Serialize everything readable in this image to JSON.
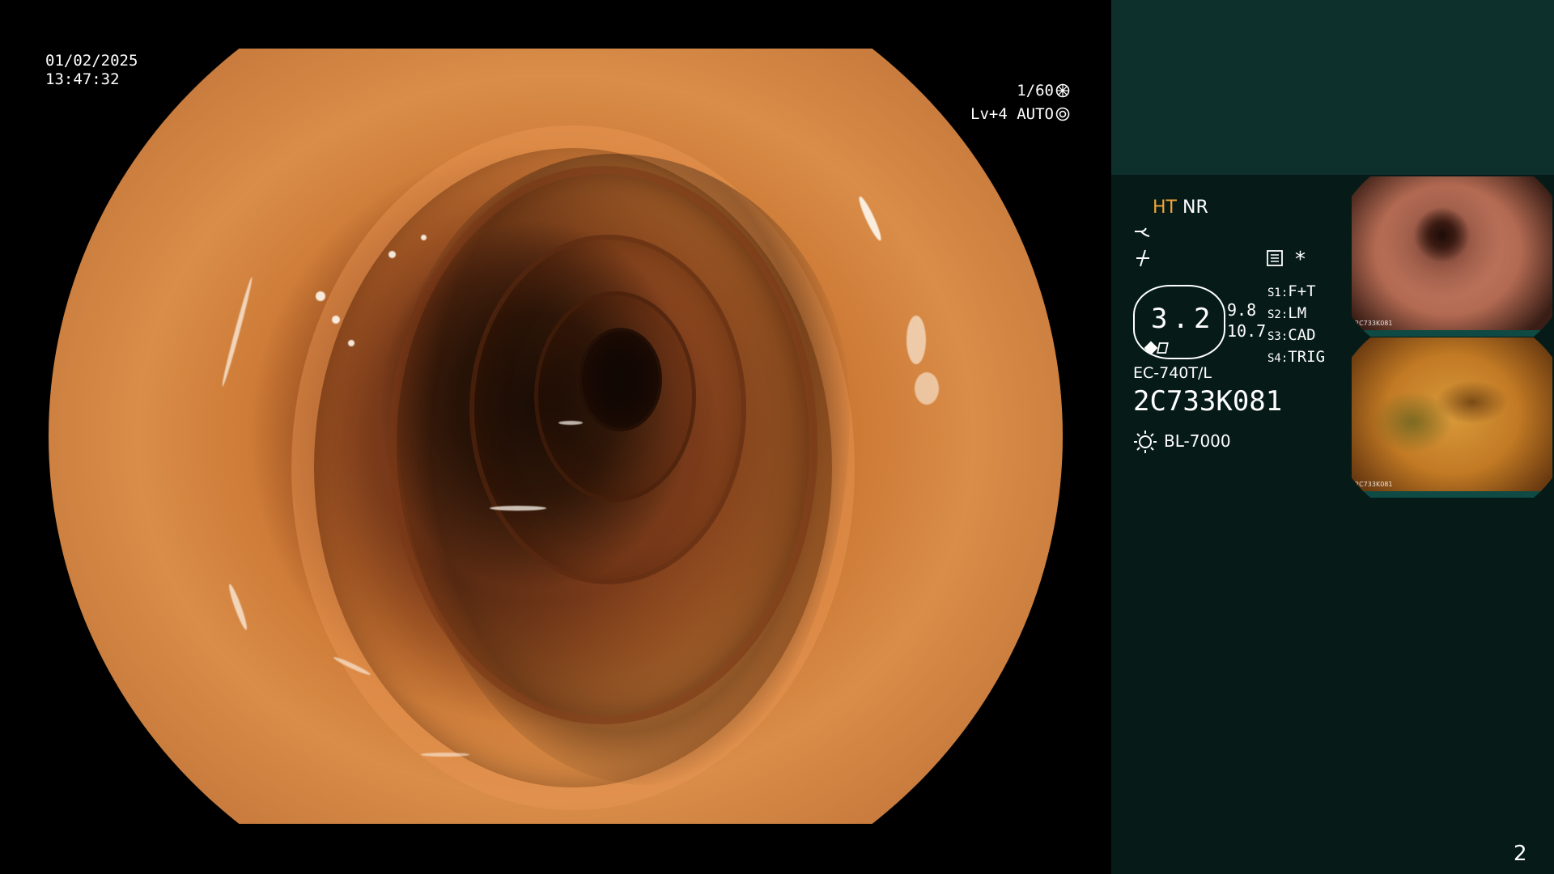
{
  "main_view": {
    "date": "01/02/2025",
    "time": "13:47:32",
    "shutter": "1/60",
    "level": "Lv+4",
    "iris": "AUTO"
  },
  "panel": {
    "mode_ht": "HT",
    "mode_nr": "NR",
    "enhancement_value": "3.2",
    "value_a": "9.8",
    "value_b": "10.7",
    "switches": [
      {
        "key": "S1",
        "value": "F+T"
      },
      {
        "key": "S2",
        "value": "LM"
      },
      {
        "key": "S3",
        "value": "CAD"
      },
      {
        "key": "S4",
        "value": "TRIG"
      }
    ],
    "scope_model": "EC-740T/L",
    "scope_serial": "2C733K081",
    "light_source": "BL-7000",
    "asterisk": "*"
  },
  "thumbnails": [
    {
      "caption": "2C733K081"
    },
    {
      "caption": "2C733K081"
    }
  ],
  "page_number": "2",
  "colors": {
    "panel_bg": "#061b18",
    "panel_top_bg": "#0d302c",
    "ht_accent": "#f0a53a",
    "text": "#ffffff"
  }
}
